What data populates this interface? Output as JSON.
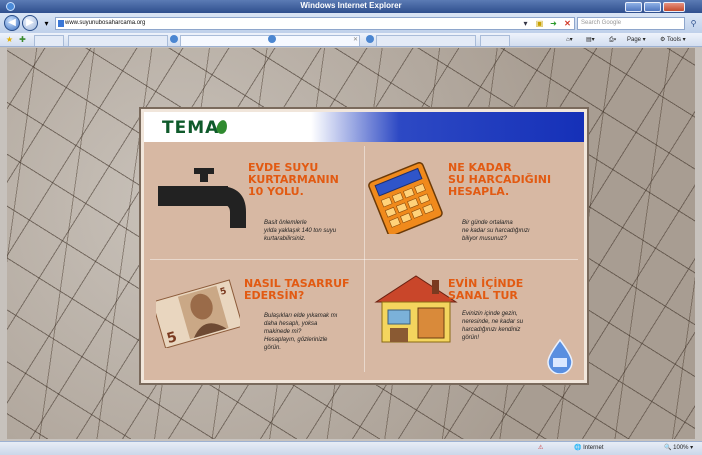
{
  "window": {
    "title": "Windows Internet Explorer"
  },
  "address_bar": {
    "url": "www.suyunubosaharcama.org",
    "search_placeholder": "Search Google"
  },
  "command_bar": {
    "page_label": "Page",
    "tools_label": "Tools"
  },
  "site": {
    "logo": "TEMA",
    "sections": [
      {
        "title": "EVDE SUYU\nKURTARMANIN\n10 YOLU.",
        "description": "Basit önlemlerle\nyılda yaklaşık 140 ton suyu\nkurtarabilirsiniz."
      },
      {
        "title": "NE KADAR\nSU HARCADIĞINI\nHESAPLA.",
        "description": "Bir günde ortalama\nne kadar su harcadığınızı\nbiliyor musunuz?"
      },
      {
        "title": "NASIL TASARRUF\nEDERSİN?",
        "description": "Bulaşıkları elde yıkamak mı\ndaha hesaplı, yoksa\nmakinede mi?\nHesaplayın, gözlerinizle\ngörün."
      },
      {
        "title": "EVİN İÇİNDE\nSANAL TUR",
        "description": "Evinizin içinde gezin,\nneresinde, ne kadar su\nharcadığınızı kendiniz\ngörün!"
      }
    ]
  },
  "status_bar": {
    "zone": "Internet",
    "zoom": "100%"
  },
  "colors": {
    "title_orange": "#e25a12",
    "header_blue": "#1530b8",
    "card_bg": "#d7b8a3"
  }
}
